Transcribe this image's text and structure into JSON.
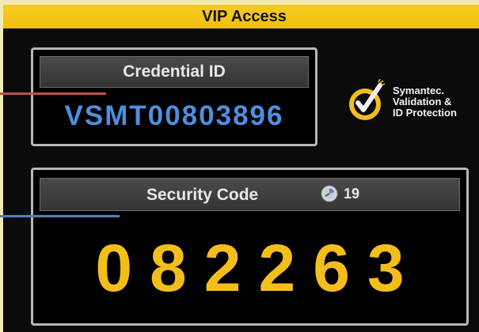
{
  "window": {
    "title": "VIP Access"
  },
  "credential": {
    "label": "Credential ID",
    "value": "VSMT00803896"
  },
  "security": {
    "label": "Security Code",
    "timer": "19",
    "code": "082263"
  },
  "logo": {
    "line1": "Symantec.",
    "line2": "Validation &",
    "line3": "ID Protection"
  },
  "colors": {
    "title_bar": "#f3c61a",
    "credential_text": "#4d8fe0",
    "security_code": "#f3be1c",
    "callout_red": "#c0504d",
    "callout_blue": "#4f81bd"
  },
  "icons": {
    "timer": "clock-icon",
    "logo": "symantec-check-logo-icon"
  }
}
